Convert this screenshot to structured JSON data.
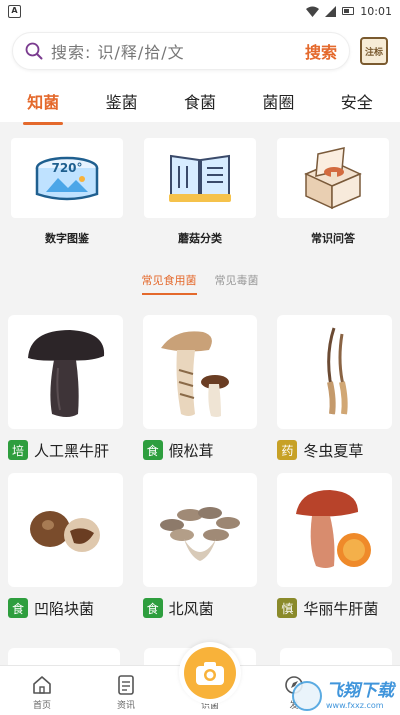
{
  "statusbar": {
    "app_icon": "A",
    "time": "10:01"
  },
  "search": {
    "placeholder": "搜索: 识/释/拾/文",
    "button": "搜索",
    "register_label": "注标"
  },
  "tabs": [
    {
      "label": "知菌",
      "active": true
    },
    {
      "label": "鉴菌",
      "active": false
    },
    {
      "label": "食菌",
      "active": false
    },
    {
      "label": "菌圈",
      "active": false
    },
    {
      "label": "安全",
      "active": false
    }
  ],
  "features": [
    {
      "label": "数字图鉴",
      "icon": "panorama-720-icon",
      "icon_text": "720°"
    },
    {
      "label": "蘑菇分类",
      "icon": "menu-book-icon"
    },
    {
      "label": "常识问答",
      "icon": "mushroom-box-icon"
    }
  ],
  "subtabs": [
    {
      "label": "常见食用菌",
      "active": true
    },
    {
      "label": "常见毒菌",
      "active": false
    }
  ],
  "mushrooms": [
    {
      "badge": "培",
      "badge_color": "#2e9e3e",
      "name": "人工黑牛肝"
    },
    {
      "badge": "食",
      "badge_color": "#2e9e3e",
      "name": "假松茸"
    },
    {
      "badge": "药",
      "badge_color": "#c7a126",
      "name": "冬虫夏草"
    },
    {
      "badge": "食",
      "badge_color": "#2e9e3e",
      "name": "凹陷块菌"
    },
    {
      "badge": "食",
      "badge_color": "#2e9e3e",
      "name": "北风菌"
    },
    {
      "badge": "慎",
      "badge_color": "#8a8a2a",
      "name": "华丽牛肝菌"
    }
  ],
  "bottom_nav": [
    {
      "label": "首页",
      "icon": "home-icon"
    },
    {
      "label": "资讯",
      "icon": "document-icon"
    },
    {
      "label": "识菌",
      "icon": "camera-icon"
    },
    {
      "label": "发",
      "icon": "discover-icon"
    }
  ],
  "watermark": {
    "title": "飞翔下载",
    "url": "www.fxxz.com"
  },
  "colors": {
    "accent": "#e4692c",
    "camera": "#f8b23a"
  }
}
